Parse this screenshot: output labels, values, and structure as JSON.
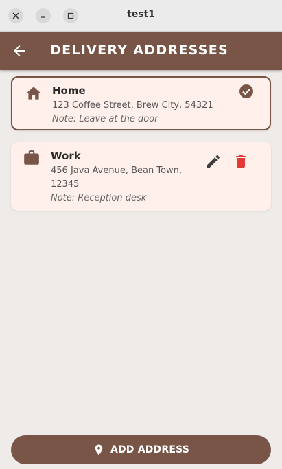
{
  "window": {
    "title": "test1"
  },
  "appbar": {
    "title": "DELIVERY ADDRESSES"
  },
  "addresses": [
    {
      "name": "Home",
      "icon": "home-icon",
      "address": "123 Coffee Street, Brew City, 54321",
      "note": "Note: Leave at the door",
      "selected": true
    },
    {
      "name": "Work",
      "icon": "briefcase-icon",
      "address": "456 Java Avenue, Bean Town, 12345",
      "note": "Note: Reception desk",
      "selected": false
    }
  ],
  "actions": {
    "add_address_label": "ADD ADDRESS"
  },
  "colors": {
    "primary": "#795548",
    "background": "#efebe9",
    "card": "#fff0ec",
    "delete": "#e53935"
  }
}
